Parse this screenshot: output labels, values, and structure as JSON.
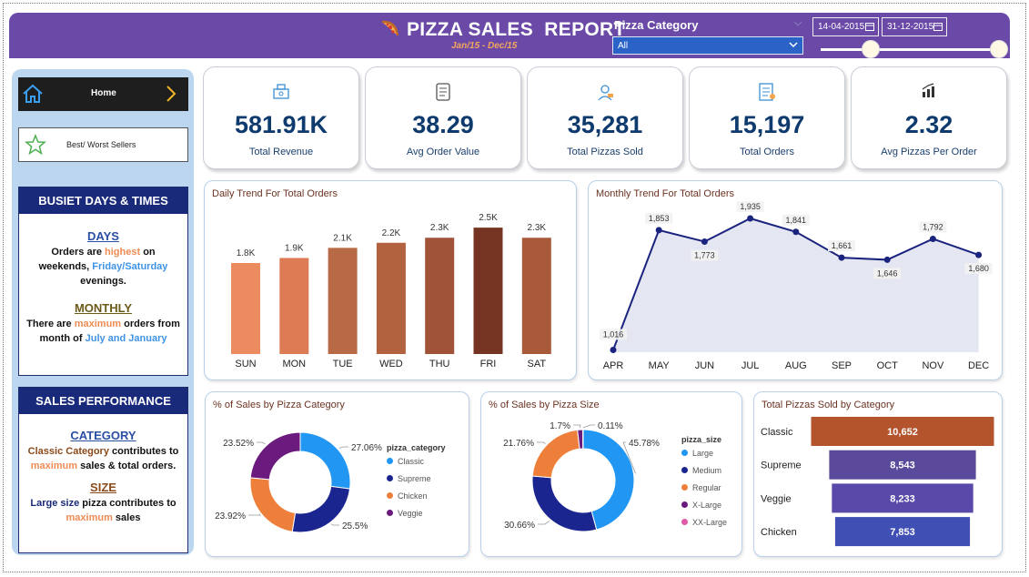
{
  "header": {
    "title": "PIZZA SALES  REPORT",
    "subtitle": "Jan/15 - Dec/15",
    "category_label": "Pizza Category",
    "category_value": "All",
    "date_start": "14-04-2015",
    "date_end": "31-12-2015",
    "slider_start": 0.28,
    "slider_end": 1.0,
    "accent": "#6a4aa6"
  },
  "sidebar": {
    "home_label": "Home",
    "best_worst_label": "Best/ Worst Sellers",
    "busiest": {
      "heading": "BUSIET DAYS & TIMES",
      "days_title": "DAYS",
      "days_p1": "Orders are ",
      "days_hl1": "highest",
      "days_p2": " on weekends, ",
      "days_hl2": "Friday/Saturday",
      "days_p3": " evenings.",
      "monthly_title": "MONTHLY",
      "monthly_p1": "There are ",
      "monthly_hl1": "maximum",
      "monthly_p2": " orders from month of ",
      "monthly_hl2": "July and January"
    },
    "sales": {
      "heading": "SALES PERFORMANCE",
      "category_title": "CATEGORY",
      "cat_hl1": "Classic Category",
      "cat_p1": " contributes to ",
      "cat_hl2": "maximum",
      "cat_p2": " sales & total orders.",
      "size_title": "SIZE",
      "size_p1": "Large size",
      "size_p2": " pizza contributes to ",
      "size_hl": "maximum",
      "size_p3": " sales"
    }
  },
  "kpis": [
    {
      "value": "581.91K",
      "label": "Total Revenue",
      "icon": "money-bag-icon"
    },
    {
      "value": "38.29",
      "label": "Avg Order Value",
      "icon": "receipt-icon"
    },
    {
      "value": "35,281",
      "label": "Total Pizzas Sold",
      "icon": "chef-icon"
    },
    {
      "value": "15,197",
      "label": "Total Orders",
      "icon": "order-list-icon"
    },
    {
      "value": "2.32",
      "label": "Avg Pizzas Per Order",
      "icon": "bar-growth-icon"
    }
  ],
  "chart_data": [
    {
      "type": "bar",
      "title": "Daily Trend For Total Orders",
      "categories": [
        "SUN",
        "MON",
        "TUE",
        "WED",
        "THU",
        "FRI",
        "SAT"
      ],
      "values": [
        1.8,
        1.9,
        2.1,
        2.2,
        2.3,
        2.5,
        2.3
      ],
      "labels": [
        "1.8K",
        "1.9K",
        "2.1K",
        "2.2K",
        "2.3K",
        "2.5K",
        "2.3K"
      ],
      "colors": [
        "#ec8a60",
        "#dd7b55",
        "#b86a47",
        "#b3623f",
        "#a05338",
        "#743421",
        "#a85a3a"
      ],
      "ylim": [
        0,
        2.7
      ]
    },
    {
      "type": "area",
      "title": "Monthly Trend For Total Orders",
      "categories": [
        "APR",
        "MAY",
        "JUN",
        "JUL",
        "AUG",
        "SEP",
        "OCT",
        "NOV",
        "DEC"
      ],
      "values": [
        1016,
        1853,
        1773,
        1935,
        1841,
        1661,
        1646,
        1792,
        1680
      ],
      "labels": [
        "1,016",
        "1,853",
        "1,773",
        "1,935",
        "1,841",
        "1,661",
        "1,646",
        "1,792",
        "1,680"
      ],
      "ylim": [
        1000,
        2000
      ],
      "color": "#1a237e",
      "fill": "#e4e6f1"
    },
    {
      "type": "pie",
      "title": "% of Sales by Pizza Category",
      "legend_title": "pizza_category",
      "slices": [
        {
          "name": "Classic",
          "value": 27.06,
          "label": "27.06%",
          "color": "#2196f3"
        },
        {
          "name": "Supreme",
          "value": 25.5,
          "label": "25.5%",
          "color": "#1a2590"
        },
        {
          "name": "Chicken",
          "value": 23.92,
          "label": "23.92%",
          "color": "#ee7f3b"
        },
        {
          "name": "Veggie",
          "value": 23.52,
          "label": "23.52%",
          "color": "#6b1a7d"
        }
      ]
    },
    {
      "type": "pie",
      "title": "% of Sales by Pizza Size",
      "legend_title": "pizza_size",
      "slices": [
        {
          "name": "Large",
          "value": 45.78,
          "label": "45.78%",
          "color": "#2196f3"
        },
        {
          "name": "Medium",
          "value": 30.66,
          "label": "30.66%",
          "color": "#1a2590"
        },
        {
          "name": "Regular",
          "value": 21.76,
          "label": "21.76%",
          "color": "#ee7f3b"
        },
        {
          "name": "X-Large",
          "value": 1.7,
          "label": "1.7%",
          "color": "#6b1a7d"
        },
        {
          "name": "XX-Large",
          "value": 0.11,
          "label": "0.11%",
          "color": "#e05aa8"
        }
      ]
    },
    {
      "type": "bar",
      "title": "Total Pizzas Sold by Category",
      "categories": [
        "Classic",
        "Supreme",
        "Veggie",
        "Chicken"
      ],
      "values": [
        10652,
        8543,
        8233,
        7853
      ],
      "labels": [
        "10,652",
        "8,543",
        "8,233",
        "7,853"
      ],
      "colors": [
        "#b3542d",
        "#5b4a9c",
        "#5a49a8",
        "#3f4fb3"
      ]
    }
  ]
}
